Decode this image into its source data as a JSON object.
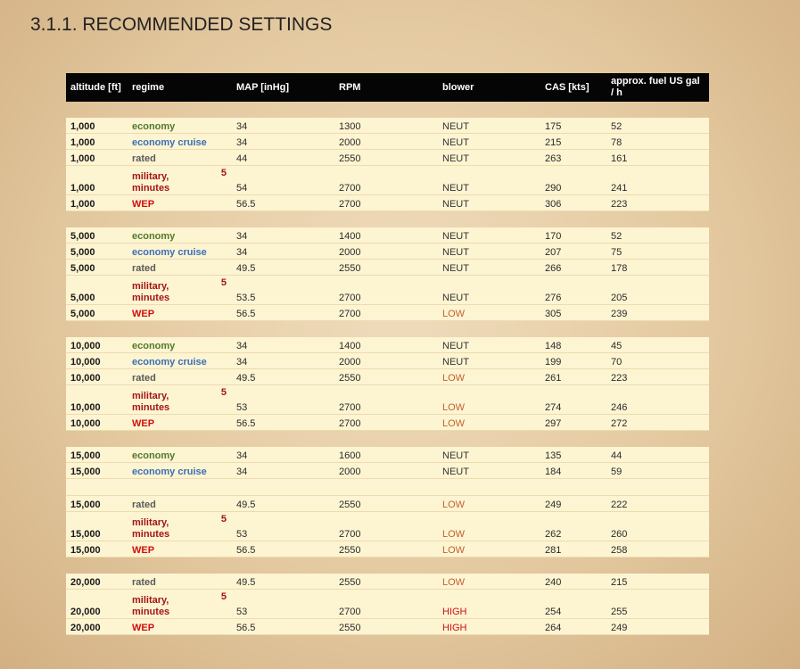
{
  "title": "3.1.1. RECOMMENDED SETTINGS",
  "headers": [
    "altitude [ft]",
    "regime",
    "MAP [inHg]",
    "RPM",
    "blower",
    "CAS [kts]",
    "approx. fuel US gal / h"
  ],
  "regime_labels": {
    "economy": "economy",
    "economy_cruise": "economy cruise",
    "rated": "rated",
    "military_line1": "military,",
    "military_5": "5",
    "military_line2": "minutes",
    "wep": "WEP"
  },
  "groups": [
    {
      "rows": [
        {
          "alt": "1,000",
          "map": "34",
          "rpm": "1300",
          "blower": "NEUT",
          "cas": "175",
          "fuel": "52"
        },
        {
          "alt": "1,000",
          "map": "34",
          "rpm": "2000",
          "blower": "NEUT",
          "cas": "215",
          "fuel": "78"
        },
        {
          "alt": "1,000",
          "map": "44",
          "rpm": "2550",
          "blower": "NEUT",
          "cas": "263",
          "fuel": "161"
        },
        {
          "alt": "1,000",
          "map": "54",
          "rpm": "2700",
          "blower": "NEUT",
          "cas": "290",
          "fuel": "241"
        },
        {
          "alt": "1,000",
          "map": "56.5",
          "rpm": "2700",
          "blower": "NEUT",
          "cas": "306",
          "fuel": "223"
        }
      ]
    },
    {
      "rows": [
        {
          "alt": "5,000",
          "map": "34",
          "rpm": "1400",
          "blower": "NEUT",
          "cas": "170",
          "fuel": "52"
        },
        {
          "alt": "5,000",
          "map": "34",
          "rpm": "2000",
          "blower": "NEUT",
          "cas": "207",
          "fuel": "75"
        },
        {
          "alt": "5,000",
          "map": "49.5",
          "rpm": "2550",
          "blower": "NEUT",
          "cas": "266",
          "fuel": "178"
        },
        {
          "alt": "5,000",
          "map": "53.5",
          "rpm": "2700",
          "blower": "NEUT",
          "cas": "276",
          "fuel": "205"
        },
        {
          "alt": "5,000",
          "map": "56.5",
          "rpm": "2700",
          "blower": "LOW",
          "cas": "305",
          "fuel": "239"
        }
      ]
    },
    {
      "rows": [
        {
          "alt": "10,000",
          "map": "34",
          "rpm": "1400",
          "blower": "NEUT",
          "cas": "148",
          "fuel": "45"
        },
        {
          "alt": "10,000",
          "map": "34",
          "rpm": "2000",
          "blower": "NEUT",
          "cas": "199",
          "fuel": "70"
        },
        {
          "alt": "10,000",
          "map": "49.5",
          "rpm": "2550",
          "blower": "LOW",
          "cas": "261",
          "fuel": "223"
        },
        {
          "alt": "10,000",
          "map": "53",
          "rpm": "2700",
          "blower": "LOW",
          "cas": "274",
          "fuel": "246"
        },
        {
          "alt": "10,000",
          "map": "56.5",
          "rpm": "2700",
          "blower": "LOW",
          "cas": "297",
          "fuel": "272"
        }
      ]
    },
    {
      "rows": [
        {
          "alt": "15,000",
          "map": "34",
          "rpm": "1600",
          "blower": "NEUT",
          "cas": "135",
          "fuel": "44"
        },
        {
          "alt": "15,000",
          "map": "34",
          "rpm": "2000",
          "blower": "NEUT",
          "cas": "184",
          "fuel": "59"
        },
        {
          "alt": "15,000",
          "map": "49.5",
          "rpm": "2550",
          "blower": "LOW",
          "cas": "249",
          "fuel": "222"
        },
        {
          "alt": "15,000",
          "map": "53",
          "rpm": "2700",
          "blower": "LOW",
          "cas": "262",
          "fuel": "260"
        },
        {
          "alt": "15,000",
          "map": "56.5",
          "rpm": "2550",
          "blower": "LOW",
          "cas": "281",
          "fuel": "258"
        }
      ]
    },
    {
      "rows": [
        {
          "alt": "20,000",
          "map": "49.5",
          "rpm": "2550",
          "blower": "LOW",
          "cas": "240",
          "fuel": "215"
        },
        {
          "alt": "20,000",
          "map": "53",
          "rpm": "2700",
          "blower": "HIGH",
          "cas": "254",
          "fuel": "255"
        },
        {
          "alt": "20,000",
          "map": "56.5",
          "rpm": "2550",
          "blower": "HIGH",
          "cas": "264",
          "fuel": "249"
        }
      ]
    }
  ]
}
